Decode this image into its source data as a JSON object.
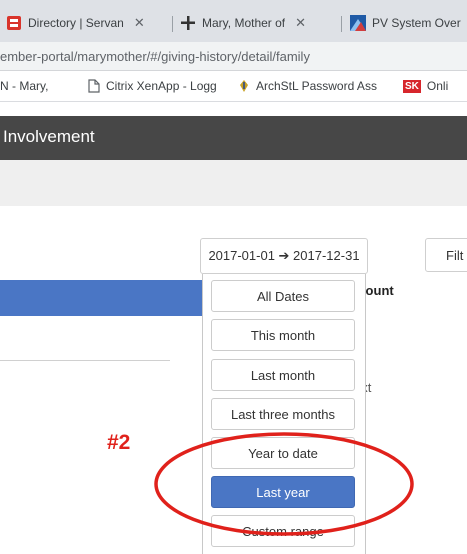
{
  "browser": {
    "tabs": [
      {
        "title": "Directory | Servan",
        "icon": "directory-favicon-icon"
      },
      {
        "title": "Mary, Mother of",
        "icon": "cross-favicon-icon"
      },
      {
        "title": "PV System Over",
        "icon": "pv-favicon-icon"
      }
    ],
    "close_glyph": "✕",
    "url": "ember-portal/marymother/#/giving-history/detail/family",
    "bookmarks": [
      {
        "label": "N - Mary,"
      },
      {
        "label": "Citrix XenApp - Logg"
      },
      {
        "label": "ArchStL Password Ass"
      },
      {
        "label": "Onli",
        "badge": "SK"
      }
    ]
  },
  "app": {
    "header_title": "Involvement"
  },
  "filters": {
    "date_range": "2017-01-01 ➔ 2017-12-31",
    "filter_label": "Filt"
  },
  "table": {
    "amount_header": "mount",
    "partial_text": "ext"
  },
  "date_menu": {
    "options": [
      "All Dates",
      "This month",
      "Last month",
      "Last three months",
      "Year to date",
      "Last year",
      "Custom range"
    ],
    "selected": "Last year"
  },
  "annotation": {
    "label": "#2",
    "color": "#e0211b"
  },
  "colors": {
    "accent": "#4a76c5",
    "header_bg": "#474747"
  }
}
